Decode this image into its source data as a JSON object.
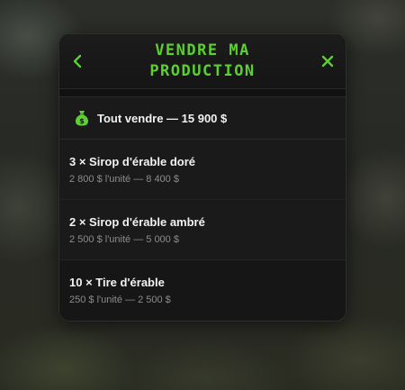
{
  "header": {
    "title": "VENDRE MA PRODUCTION",
    "back_icon": "chevron-left-icon",
    "close_icon": "close-icon"
  },
  "accent_color": "#5ccf33",
  "sell_all": {
    "icon": "money-bag-icon",
    "label": "Tout vendre — 15 900 $"
  },
  "items": [
    {
      "name": "3 × Sirop d'érable doré",
      "price": "2 800 $ l'unité — 8 400 $"
    },
    {
      "name": "2 × Sirop d'érable ambré",
      "price": "2 500 $ l'unité — 5 000 $"
    },
    {
      "name": "10 × Tire d'érable",
      "price": "250 $ l'unité — 2 500 $"
    }
  ]
}
